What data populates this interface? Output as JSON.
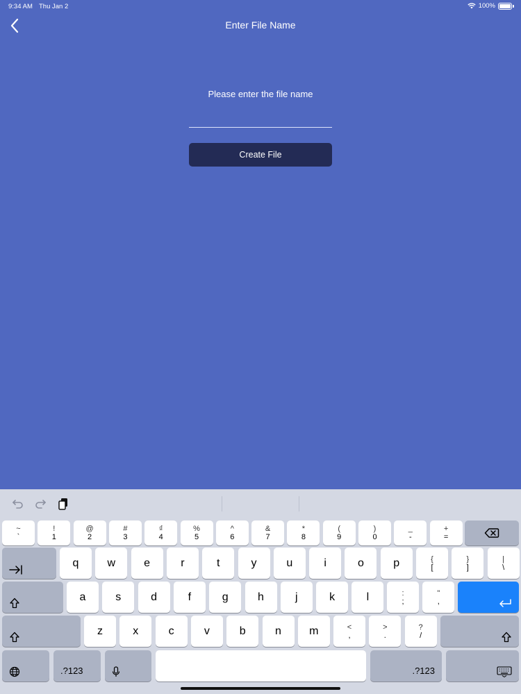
{
  "status_bar": {
    "time": "9:34 AM",
    "date": "Thu Jan 2",
    "battery": "100%"
  },
  "nav": {
    "title": "Enter File Name"
  },
  "form": {
    "prompt": "Please enter the file name",
    "input_value": "",
    "button_label": "Create File"
  },
  "keyboard": {
    "number_row": [
      {
        "top": "~",
        "bottom": "`"
      },
      {
        "top": "!",
        "bottom": "1"
      },
      {
        "top": "@",
        "bottom": "2"
      },
      {
        "top": "#",
        "bottom": "3"
      },
      {
        "top": "₫",
        "bottom": "4"
      },
      {
        "top": "%",
        "bottom": "5"
      },
      {
        "top": "^",
        "bottom": "6"
      },
      {
        "top": "&",
        "bottom": "7"
      },
      {
        "top": "*",
        "bottom": "8"
      },
      {
        "top": "(",
        "bottom": "9"
      },
      {
        "top": ")",
        "bottom": "0"
      },
      {
        "top": "_",
        "bottom": "-"
      },
      {
        "top": "+",
        "bottom": "="
      }
    ],
    "row_q": [
      "q",
      "w",
      "e",
      "r",
      "t",
      "y",
      "u",
      "i",
      "o",
      "p"
    ],
    "row_q_symbols": [
      {
        "top": "{",
        "bottom": "["
      },
      {
        "top": "}",
        "bottom": "]"
      },
      {
        "top": "|",
        "bottom": "\\"
      }
    ],
    "row_a": [
      "a",
      "s",
      "d",
      "f",
      "g",
      "h",
      "j",
      "k",
      "l"
    ],
    "row_a_symbols": [
      {
        "top": ":",
        "bottom": ";"
      },
      {
        "top": "\"",
        "bottom": ","
      }
    ],
    "row_z": [
      "z",
      "x",
      "c",
      "v",
      "b",
      "n",
      "m"
    ],
    "row_z_symbols": [
      {
        "top": "<",
        "bottom": ","
      },
      {
        "top": ">",
        "bottom": "."
      },
      {
        "top": "?",
        "bottom": "/"
      }
    ],
    "numbers_label": ".?123"
  }
}
